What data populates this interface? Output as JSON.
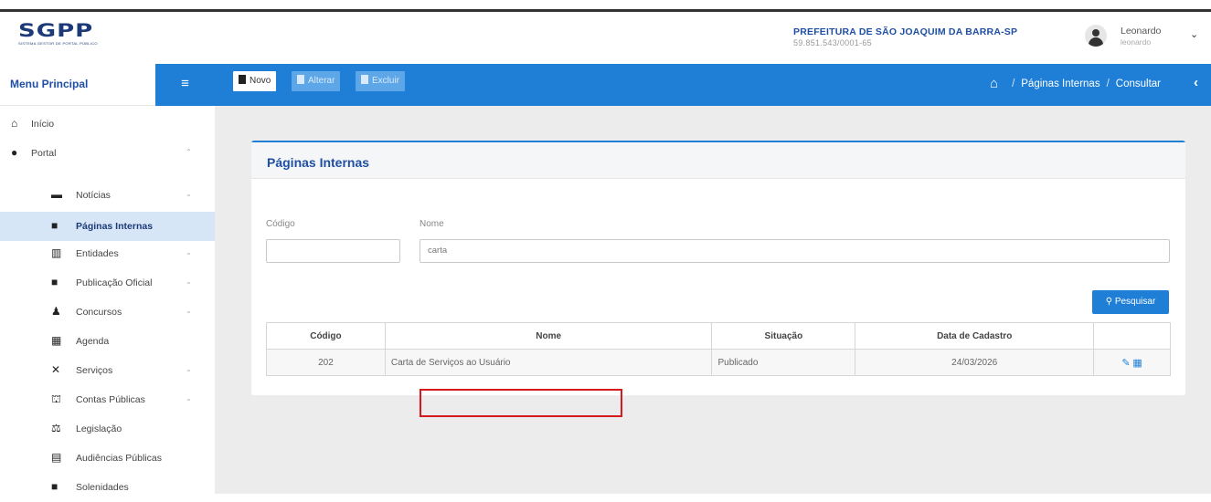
{
  "header": {
    "logo": "SGPP",
    "logo_sub": "SISTEMA GESTOR DE PORTAL PÚBLICO",
    "org_name": "PREFEITURA DE SÃO JOAQUIM DA BARRA-SP",
    "org_cnpj": "59.851.543/0001-65",
    "user_name": "Leonardo",
    "user_login": "leonardo"
  },
  "menu": {
    "title": "Menu Principal"
  },
  "toolbar": {
    "novo": "Novo",
    "alterar": "Alterar",
    "excluir": "Excluir"
  },
  "breadcrumb": [
    "Páginas Internas",
    "Consultar"
  ],
  "sidebar": {
    "items": [
      {
        "label": "Início",
        "icon": "home-icon"
      },
      {
        "label": "Portal",
        "icon": "globe-icon"
      },
      {
        "label": "Notícias",
        "icon": "newspaper-icon"
      },
      {
        "label": "Páginas Internas",
        "icon": "file-icon"
      },
      {
        "label": "Entidades",
        "icon": "building-icon"
      },
      {
        "label": "Publicação Oficial",
        "icon": "file-icon"
      },
      {
        "label": "Concursos",
        "icon": "users-icon"
      },
      {
        "label": "Agenda",
        "icon": "calendar-icon"
      },
      {
        "label": "Serviços",
        "icon": "tools-icon"
      },
      {
        "label": "Contas Públicas",
        "icon": "bank-icon"
      },
      {
        "label": "Legislação",
        "icon": "scale-icon"
      },
      {
        "label": "Audiências Públicas",
        "icon": "list-icon"
      },
      {
        "label": "Solenidades",
        "icon": "file-icon"
      }
    ]
  },
  "page": {
    "title": "Páginas Internas",
    "codigo_label": "Código",
    "nome_label": "Nome",
    "codigo_value": "",
    "nome_value": "carta",
    "search_label": "Pesquisar"
  },
  "table": {
    "headers": [
      "Código",
      "Nome",
      "Situação",
      "Data de Cadastro"
    ],
    "rows": [
      {
        "codigo": "202",
        "nome": "Carta de Serviços ao Usuário",
        "situacao": "Publicado",
        "data": "24/03/2026"
      }
    ]
  },
  "colors": {
    "primary": "#1f7fd6",
    "brand": "#1e4fa3",
    "highlight": "#d7191c"
  }
}
